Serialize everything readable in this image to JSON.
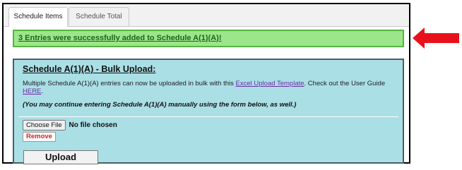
{
  "tabs": [
    {
      "label": "Schedule Items",
      "active": true
    },
    {
      "label": "Schedule Total",
      "active": false
    }
  ],
  "success_message": "3 Entries were successfully added to Schedule A(1)(A)!",
  "bulk_upload": {
    "title": "Schedule A(1)(A) - Bulk Upload:",
    "description_before": "Multiple Schedule A(1)(A) entries can now be uploaded in bulk with this ",
    "template_link": "Excel Upload Template",
    "description_middle": ". Check out the User Guide ",
    "guide_link": "HERE",
    "description_after": ".",
    "note": "(You may continue entering Schedule A(1)(A) manually using the form below, as well.)",
    "choose_file_label": "Choose File",
    "file_status": "No file chosen",
    "remove_label": "Remove",
    "upload_label": "Upload"
  },
  "colors": {
    "success_bg": "#9de58a",
    "success_text": "#17691a",
    "panel_bg": "#aadfe6",
    "arrow": "#e8111b",
    "link": "#6b2da8",
    "remove": "#cc2222"
  },
  "icons": {
    "annotation_arrow": "left-arrow-icon"
  }
}
